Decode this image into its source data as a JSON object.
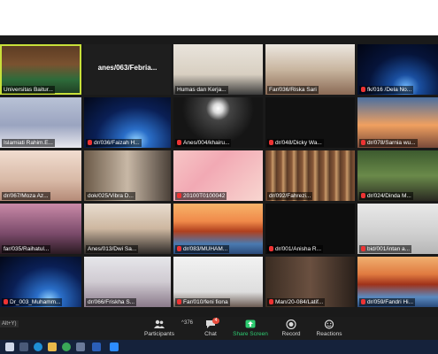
{
  "toolbar": {
    "participants_label": "Participants",
    "participants_count": "376",
    "chat_label": "Chat",
    "chat_badge": "4",
    "share_label": "Share Screen",
    "record_label": "Record",
    "reactions_label": "Reactions"
  },
  "shortcut_hint": "Alt+Y)",
  "tiles": [
    {
      "name": "Universitas Baitur..."
    },
    {
      "name": "anes/063/Febria..."
    },
    {
      "name": "Humas dan Kerja..."
    },
    {
      "name": "Far/036/Riska Sari"
    },
    {
      "name": "fk/016 /Dela No..."
    },
    {
      "name": "Islamiati Rahim.E..."
    },
    {
      "name": "dr/036/Faizah H..."
    },
    {
      "name": "Anes/004/khairu..."
    },
    {
      "name": "dr/048/Dicky Wa..."
    },
    {
      "name": "dr/078/Sarnia wu..."
    },
    {
      "name": "dr/067/Moza Az..."
    },
    {
      "name": "dok/025/Vibra D..."
    },
    {
      "name": "20100T0100042"
    },
    {
      "name": "dr/092/Fahrezi..."
    },
    {
      "name": "dr/024/Dinda M..."
    },
    {
      "name": "far/035/Raihatul..."
    },
    {
      "name": "Anes/013/Dwi Sa..."
    },
    {
      "name": "dr/083/MUHAM..."
    },
    {
      "name": "dr/001/Anisha R..."
    },
    {
      "name": "bid/001/intan a..."
    },
    {
      "name": "Dr_003_Muhamm..."
    },
    {
      "name": "dr/066/Friskha S..."
    },
    {
      "name": "Far/010/feni fiona"
    },
    {
      "name": "Man/20-084/Latif..."
    },
    {
      "name": "dr/059/Fandri Hi..."
    }
  ]
}
